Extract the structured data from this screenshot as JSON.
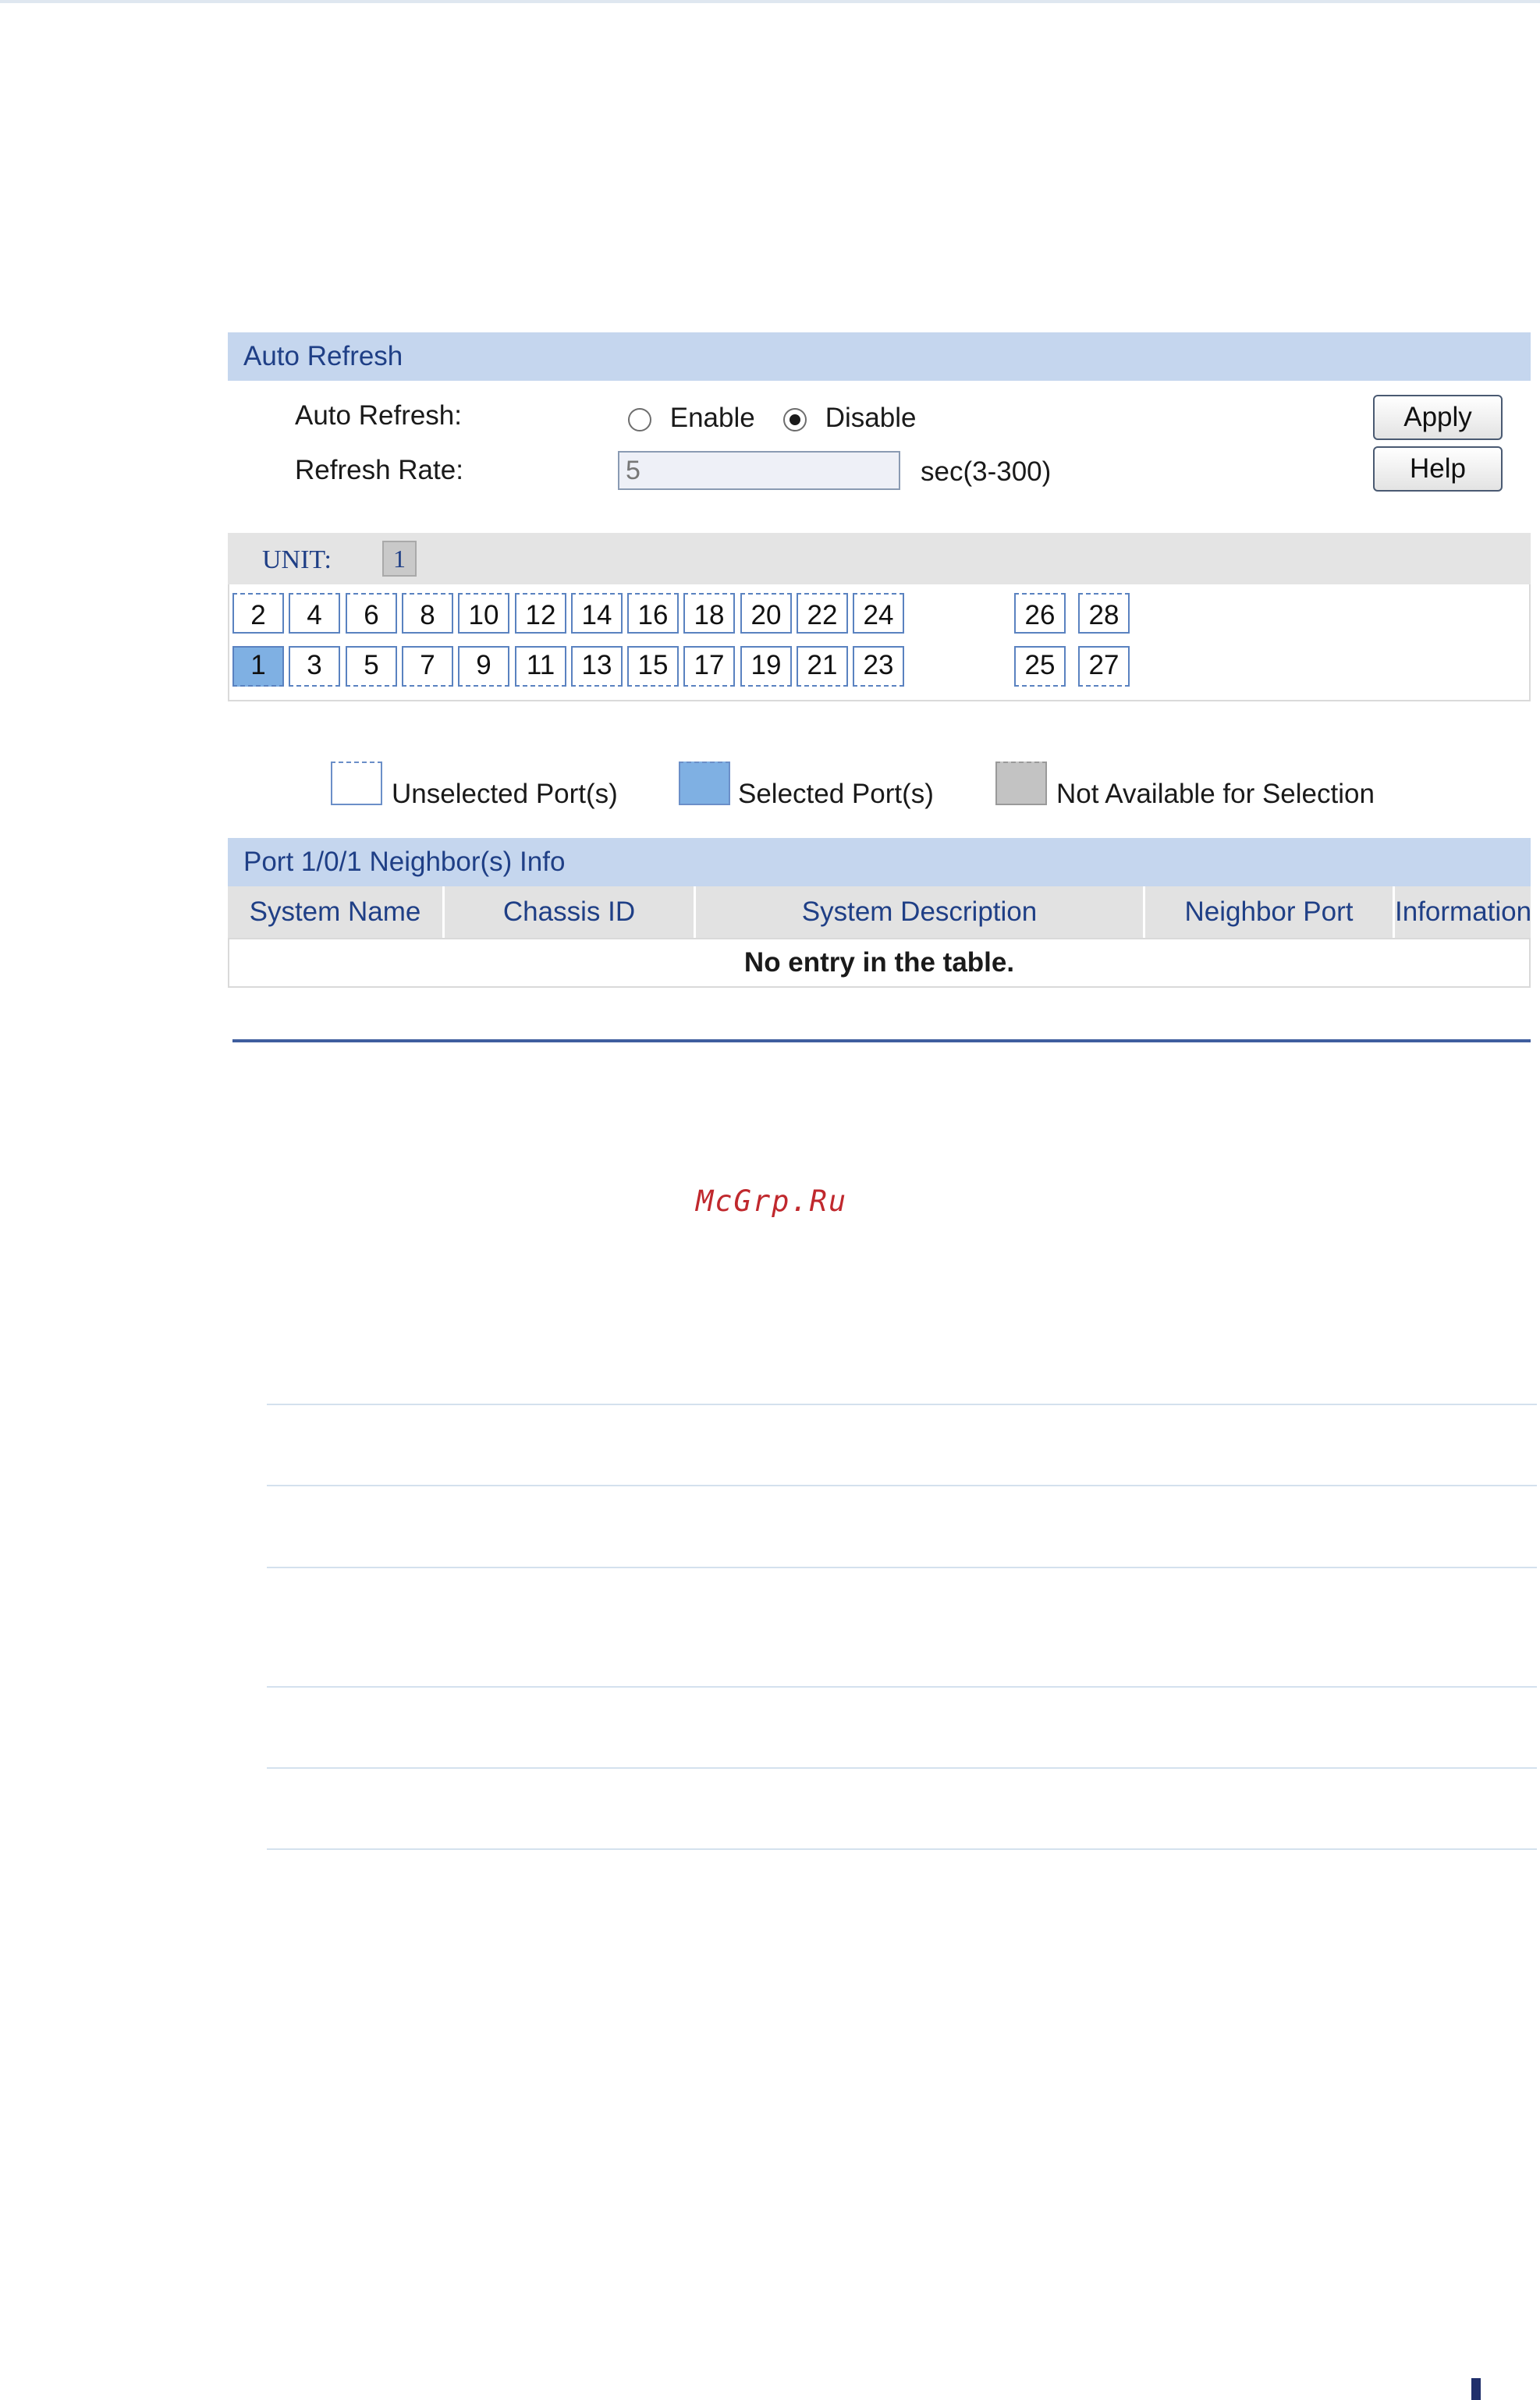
{
  "auto_refresh": {
    "section_title": "Auto Refresh",
    "auto_refresh_label": "Auto Refresh:",
    "enable_label": "Enable",
    "disable_label": "Disable",
    "selected": "Disable",
    "refresh_rate_label": "Refresh Rate:",
    "refresh_rate_value": "5",
    "refresh_rate_hint": "sec(3-300)",
    "apply_label": "Apply",
    "help_label": "Help"
  },
  "unit": {
    "label": "UNIT:",
    "value": "1"
  },
  "ports": {
    "top_row": [
      "2",
      "4",
      "6",
      "8",
      "10",
      "12",
      "14",
      "16",
      "18",
      "20",
      "22",
      "24"
    ],
    "bottom_row": [
      "1",
      "3",
      "5",
      "7",
      "9",
      "11",
      "13",
      "15",
      "17",
      "19",
      "21",
      "23"
    ],
    "extra_top": [
      "26",
      "28"
    ],
    "extra_bottom": [
      "25",
      "27"
    ],
    "selected": [
      "1"
    ]
  },
  "legend": {
    "unselected": "Unselected Port(s)",
    "selected": "Selected Port(s)",
    "not_available": "Not Available for Selection"
  },
  "neighbor_table": {
    "title": "Port 1/0/1 Neighbor(s) Info",
    "columns": [
      "System Name",
      "Chassis ID",
      "System Description",
      "Neighbor Port",
      "Information"
    ],
    "empty_message": "No entry in the table."
  },
  "watermark": "McGrp.Ru",
  "colors": {
    "header_bg": "#c5d6ee",
    "header_text": "#1f3f86",
    "selected_port": "#7fb0e3",
    "unavailable_port": "#c3c3c3",
    "rule": "#3f5e9e"
  }
}
